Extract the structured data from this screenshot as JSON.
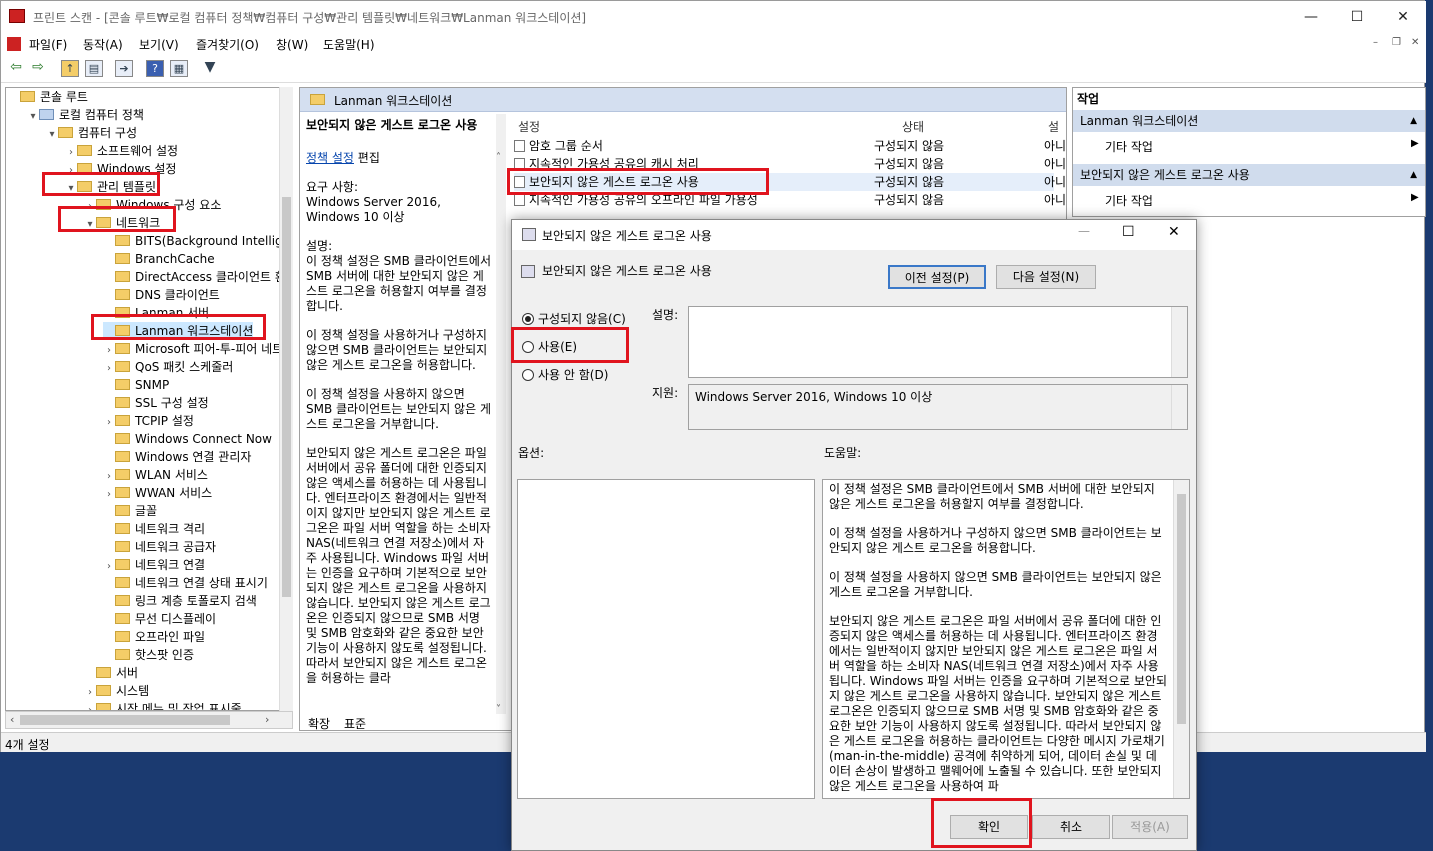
{
  "window": {
    "title": "프린트 스캔 - [콘솔 루트₩로컬 컴퓨터 정책₩컴퓨터 구성₩관리 템플릿₩네트워크₩Lanman 워크스테이션]",
    "min": "—",
    "max": "☐",
    "close": "✕"
  },
  "menu": [
    "파일(F)",
    "동작(A)",
    "보기(V)",
    "즐겨찾기(O)",
    "창(W)",
    "도움말(H)"
  ],
  "toolbar_icons": [
    "back-icon",
    "forward-icon",
    "up-folder-icon",
    "show-hide-tree-icon",
    "export-icon",
    "help-icon",
    "properties-icon",
    "filter-icon"
  ],
  "tree": [
    {
      "label": "콘솔 루트",
      "level": 0,
      "arrow": ""
    },
    {
      "label": "로컬 컴퓨터 정책",
      "level": 1,
      "arrow": "▾"
    },
    {
      "label": "컴퓨터 구성",
      "level": 2,
      "arrow": "▾"
    },
    {
      "label": "소프트웨어 설정",
      "level": 3,
      "arrow": "›"
    },
    {
      "label": "Windows 설정",
      "level": 3,
      "arrow": "›"
    },
    {
      "label": "관리 템플릿",
      "level": 3,
      "arrow": "▾"
    },
    {
      "label": "Windows 구성 요소",
      "level": 4,
      "arrow": "›"
    },
    {
      "label": "네트워크",
      "level": 4,
      "arrow": "▾"
    },
    {
      "label": "BITS(Background Intelligent",
      "level": 5,
      "arrow": ""
    },
    {
      "label": "BranchCache",
      "level": 5,
      "arrow": ""
    },
    {
      "label": "DirectAccess 클라이언트 환경",
      "level": 5,
      "arrow": ""
    },
    {
      "label": "DNS 클라이언트",
      "level": 5,
      "arrow": ""
    },
    {
      "label": "Lanman 서버",
      "level": 5,
      "arrow": ""
    },
    {
      "label": "Lanman 워크스테이션",
      "level": 5,
      "arrow": ""
    },
    {
      "label": "Microsoft 피어-투-피어 네트",
      "level": 5,
      "arrow": "›"
    },
    {
      "label": "QoS 패킷 스케줄러",
      "level": 5,
      "arrow": "›"
    },
    {
      "label": "SNMP",
      "level": 5,
      "arrow": ""
    },
    {
      "label": "SSL 구성 설정",
      "level": 5,
      "arrow": ""
    },
    {
      "label": "TCPIP 설정",
      "level": 5,
      "arrow": "›"
    },
    {
      "label": "Windows Connect Now",
      "level": 5,
      "arrow": ""
    },
    {
      "label": "Windows 연결 관리자",
      "level": 5,
      "arrow": ""
    },
    {
      "label": "WLAN 서비스",
      "level": 5,
      "arrow": "›"
    },
    {
      "label": "WWAN 서비스",
      "level": 5,
      "arrow": "›"
    },
    {
      "label": "글꼴",
      "level": 5,
      "arrow": ""
    },
    {
      "label": "네트워크 격리",
      "level": 5,
      "arrow": ""
    },
    {
      "label": "네트워크 공급자",
      "level": 5,
      "arrow": ""
    },
    {
      "label": "네트워크 연결",
      "level": 5,
      "arrow": "›"
    },
    {
      "label": "네트워크 연결 상태 표시기",
      "level": 5,
      "arrow": ""
    },
    {
      "label": "링크 계층 토폴로지 검색",
      "level": 5,
      "arrow": ""
    },
    {
      "label": "무선 디스플레이",
      "level": 5,
      "arrow": ""
    },
    {
      "label": "오프라인 파일",
      "level": 5,
      "arrow": ""
    },
    {
      "label": "핫스팟 인증",
      "level": 5,
      "arrow": ""
    },
    {
      "label": "서버",
      "level": 4,
      "arrow": ""
    },
    {
      "label": "시스템",
      "level": 4,
      "arrow": "›"
    },
    {
      "label": "시작 메뉴 및 작업 표시줄",
      "level": 4,
      "arrow": "›"
    }
  ],
  "status": "4개 설정",
  "center": {
    "header": "Lanman 워크스테이션",
    "desc_title": "보안되지 않은 게스트 로그온 사용",
    "edit_link": "정책 설정",
    "edit_suffix": " 편집",
    "desc_paragraphs": [
      "요구 사항:\nWindows Server 2016, Windows 10 이상",
      "설명:\n이 정책 설정은 SMB 클라이언트에서 SMB 서버에 대한 보안되지 않은 게스트 로그온을 허용할지 여부를 결정합니다.",
      "이 정책 설정을 사용하거나 구성하지 않으면 SMB 클라이언트는 보안되지 않은 게스트 로그온을 허용합니다.",
      "이 정책 설정을 사용하지 않으면 SMB 클라이언트는 보안되지 않은 게스트 로그온을 거부합니다.",
      "보안되지 않은 게스트 로그온은 파일 서버에서 공유 폴더에 대한 인증되지 않은 액세스를 허용하는 데 사용됩니다. 엔터프라이즈 환경에서는 일반적이지 않지만 보안되지 않은 게스트 로그온은 파일 서버 역할을 하는 소비자 NAS(네트워크 연결 저장소)에서 자주 사용됩니다. Windows 파일 서버는 인증을 요구하며 기본적으로 보안되지 않은 게스트 로그온을 사용하지 않습니다. 보안되지 않은 게스트 로그온은 인증되지 않으므로 SMB 서명 및 SMB 암호화와 같은 중요한 보안 기능이 사용하지 않도록 설정됩니다. 따라서 보안되지 않은 게스트 로그온을 허용하는 클라"
    ],
    "columns": {
      "setting": "설정",
      "state": "상태",
      "comment": "설"
    },
    "rows": [
      {
        "setting": "암호 그룹 순서",
        "state": "구성되지 않음",
        "comment": "아니"
      },
      {
        "setting": "지속적인 가용성 공유의 캐시 처리",
        "state": "구성되지 않음",
        "comment": "아니"
      },
      {
        "setting": "보안되지 않은 게스트 로그온 사용",
        "state": "구성되지 않음",
        "comment": "아니"
      },
      {
        "setting": "지속적인 가용성 공유의 오프라인 파일 가용성",
        "state": "구성되지 않음",
        "comment": "아니"
      }
    ],
    "tabs": [
      "확장",
      "표준"
    ]
  },
  "actions": {
    "header": "작업",
    "groups": [
      {
        "title": "Lanman 워크스테이션",
        "item": "기타 작업"
      },
      {
        "title": "보안되지 않은 게스트 로그온 사용",
        "item": "기타 작업"
      }
    ]
  },
  "dialog": {
    "title": "보안되지 않은 게스트 로그온 사용",
    "setting_name": "보안되지 않은 게스트 로그온 사용",
    "prev_btn": "이전 설정(P)",
    "next_btn": "다음 설정(N)",
    "radios": [
      "구성되지 않음(C)",
      "사용(E)",
      "사용 안 함(D)"
    ],
    "selected": 0,
    "comment_label": "설명:",
    "support_label": "지원:",
    "support_value": "Windows Server 2016, Windows 10 이상",
    "options_label": "옵션:",
    "help_label": "도움말:",
    "help_paragraphs": [
      "이 정책 설정은 SMB 클라이언트에서 SMB 서버에 대한 보안되지 않은 게스트 로그온을 허용할지 여부를 결정합니다.",
      "이 정책 설정을 사용하거나 구성하지 않으면 SMB 클라이언트는 보안되지 않은 게스트 로그온을 허용합니다.",
      "이 정책 설정을 사용하지 않으면 SMB 클라이언트는 보안되지 않은 게스트 로그온을 거부합니다.",
      "보안되지 않은 게스트 로그온은 파일 서버에서 공유 폴더에 대한 인증되지 않은 액세스를 허용하는 데 사용됩니다. 엔터프라이즈 환경에서는 일반적이지 않지만 보안되지 않은 게스트 로그온은 파일 서버 역할을 하는 소비자 NAS(네트워크 연결 저장소)에서 자주 사용됩니다. Windows 파일 서버는 인증을 요구하며 기본적으로 보안되지 않은 게스트 로그온을 사용하지 않습니다. 보안되지 않은 게스트 로그온은 인증되지 않으므로 SMB 서명 및 SMB 암호화와 같은 중요한 보안 기능이 사용하지 않도록 설정됩니다. 따라서 보안되지 않은 게스트 로그온을 허용하는 클라이언트는 다양한 메시지 가로채기(man-in-the-middle) 공격에 취약하게 되어, 데이터 손실 및 데이터 손상이 발생하고 맬웨어에 노출될 수 있습니다. 또한 보안되지 않은 게스트 로그온을 사용하여 파"
    ],
    "ok": "확인",
    "cancel": "취소",
    "apply": "적용(A)"
  },
  "colors": {
    "highlight": "#e0141e",
    "pane_header": "#d4dff0",
    "desktop": "#1b3a70"
  }
}
